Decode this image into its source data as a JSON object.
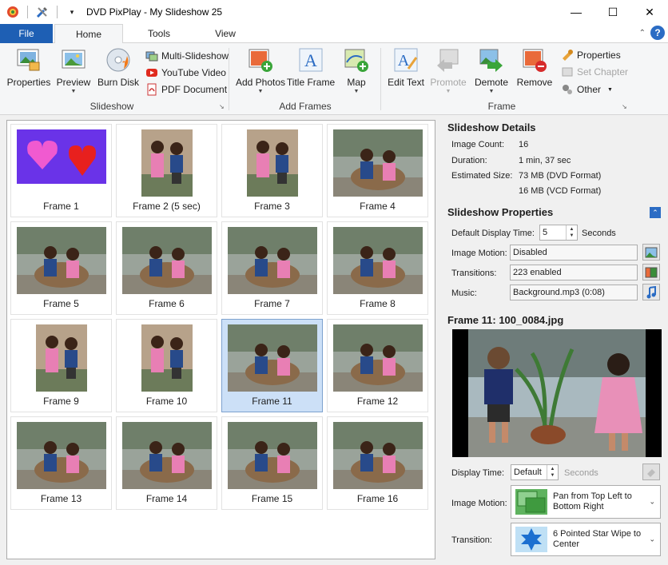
{
  "window": {
    "title": "DVD PixPlay - My Slideshow 25",
    "controls": [
      "minimize",
      "maximize",
      "close"
    ]
  },
  "tabs": {
    "file": "File",
    "home": "Home",
    "tools": "Tools",
    "view": "View"
  },
  "ribbon": {
    "slideshow": {
      "label": "Slideshow",
      "properties": "Properties",
      "preview": "Preview",
      "burn_disk": "Burn Disk",
      "multi_slideshow": "Multi-Slideshow",
      "youtube_video": "YouTube Video",
      "pdf_document": "PDF Document"
    },
    "add_frames": {
      "label": "Add Frames",
      "add_photos": "Add Photos",
      "title_frame": "Title Frame",
      "map": "Map"
    },
    "frame": {
      "label": "Frame",
      "edit_text": "Edit Text",
      "promote": "Promote",
      "demote": "Demote",
      "remove": "Remove",
      "properties": "Properties",
      "set_chapter": "Set Chapter",
      "other": "Other"
    }
  },
  "frames": [
    {
      "label": "Frame 1",
      "kind": "hearts",
      "selected": false
    },
    {
      "label": "Frame 2  (5 sec)",
      "kind": "portrait",
      "selected": false
    },
    {
      "label": "Frame 3",
      "kind": "portrait",
      "selected": false
    },
    {
      "label": "Frame 4",
      "kind": "landscape",
      "selected": false
    },
    {
      "label": "Frame 5",
      "kind": "landscape",
      "selected": false
    },
    {
      "label": "Frame 6",
      "kind": "landscape",
      "selected": false
    },
    {
      "label": "Frame 7",
      "kind": "landscape",
      "selected": false
    },
    {
      "label": "Frame 8",
      "kind": "landscape",
      "selected": false
    },
    {
      "label": "Frame 9",
      "kind": "portrait",
      "selected": false
    },
    {
      "label": "Frame 10",
      "kind": "portrait",
      "selected": false
    },
    {
      "label": "Frame 11",
      "kind": "landscape",
      "selected": true
    },
    {
      "label": "Frame 12",
      "kind": "landscape",
      "selected": false
    },
    {
      "label": "Frame 13",
      "kind": "landscape",
      "selected": false
    },
    {
      "label": "Frame 14",
      "kind": "landscape",
      "selected": false
    },
    {
      "label": "Frame 15",
      "kind": "landscape",
      "selected": false
    },
    {
      "label": "Frame 16",
      "kind": "landscape",
      "selected": false
    }
  ],
  "details": {
    "heading": "Slideshow Details",
    "image_count_label": "Image Count:",
    "image_count": "16",
    "duration_label": "Duration:",
    "duration": "1 min, 37 sec",
    "size_label": "Estimated Size:",
    "size_dvd": "73 MB (DVD Format)",
    "size_vcd": "16 MB (VCD Format)"
  },
  "properties": {
    "heading": "Slideshow Properties",
    "display_time_label": "Default Display Time:",
    "display_time": "5",
    "display_time_unit": "Seconds",
    "image_motion_label": "Image Motion:",
    "image_motion": "Disabled",
    "transitions_label": "Transitions:",
    "transitions": "223 enabled",
    "music_label": "Music:",
    "music": "Background.mp3 (0:08)"
  },
  "frame_panel": {
    "heading": "Frame 11: 100_0084.jpg",
    "display_time_label": "Display Time:",
    "display_time": "Default",
    "display_time_unit": "Seconds",
    "image_motion_label": "Image Motion:",
    "image_motion": "Pan from Top Left to Bottom Right",
    "transition_label": "Transition:",
    "transition": "6 Pointed Star Wipe to Center"
  },
  "colors": {
    "accent": "#1e5fb4",
    "selected_cell": "#cce0f7"
  }
}
